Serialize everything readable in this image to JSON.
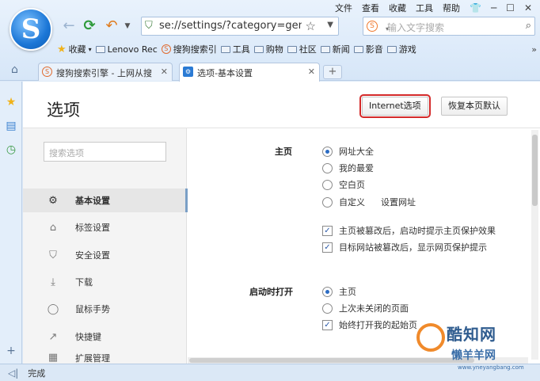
{
  "menubar": {
    "items": [
      "文件",
      "查看",
      "收藏",
      "工具",
      "帮助"
    ],
    "controls": [
      "─",
      "☐",
      "✕"
    ]
  },
  "nav": {
    "url": "se://settings/?category=gen",
    "search_placeholder": "输入文字搜索"
  },
  "bookmarks": {
    "items": [
      "收藏",
      "Lenovo Rec",
      "搜狗搜索引",
      "工具",
      "购物",
      "社区",
      "新闻",
      "影音",
      "游戏"
    ],
    "more": "»"
  },
  "tabs": [
    {
      "label": "搜狗搜索引擎 - 上网从搜",
      "close": "✕"
    },
    {
      "label": "选项-基本设置",
      "close": "✕"
    }
  ],
  "page": {
    "title": "选项",
    "internet_options_btn": "Internet选项",
    "restore_default_btn": "恢复本页默认"
  },
  "sidebar": {
    "search_placeholder": "搜索选项",
    "items": [
      {
        "label": "基本设置",
        "icon": "⚙"
      },
      {
        "label": "标签设置",
        "icon": "⌂"
      },
      {
        "label": "安全设置",
        "icon": "⛉"
      },
      {
        "label": "下载",
        "icon": "⤓"
      },
      {
        "label": "鼠标手势",
        "icon": "◯"
      },
      {
        "label": "快捷键",
        "icon": "↗"
      },
      {
        "label": "扩展管理",
        "icon": "▦"
      }
    ]
  },
  "homepage": {
    "label": "主页",
    "options": [
      "网址大全",
      "我的最爱",
      "空白页",
      "自定义"
    ],
    "custom_link": "设置网址",
    "checks": [
      "主页被篡改后，启动时提示主页保护效果",
      "目标网站被篡改后，显示网页保护提示"
    ]
  },
  "startup": {
    "label": "启动时打开",
    "options": [
      "主页",
      "上次未关闭的页面"
    ],
    "check": "始终打开我的起始页"
  },
  "status": {
    "text": "完成"
  },
  "watermark": {
    "title": "酷知网",
    "sub": "懒羊羊网",
    "url": "www.yneyangbang.com"
  },
  "colors": {
    "accent": "#2b6cc4",
    "highlight": "#d42a2a",
    "chrome": "#dce9f7"
  }
}
